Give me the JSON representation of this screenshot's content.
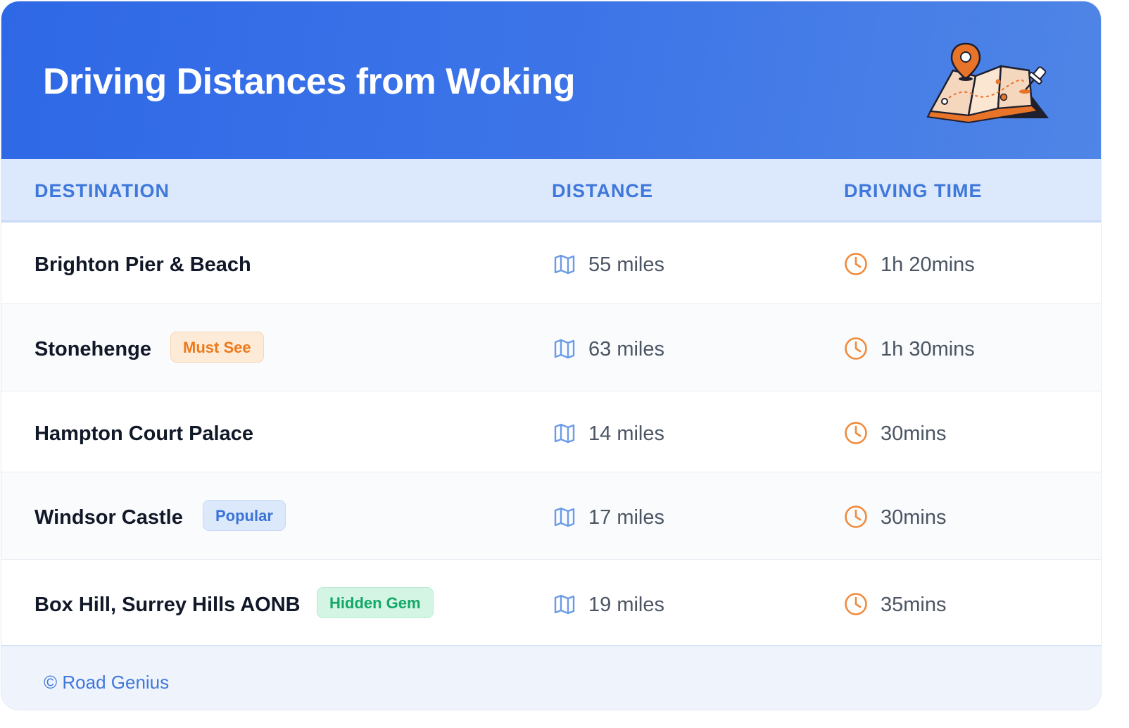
{
  "header": {
    "title": "Driving Distances from Woking",
    "illustration_icon": "map-with-pins-icon",
    "background_color": "#2f68e6"
  },
  "columns": {
    "destination": "DESTINATION",
    "distance": "DISTANCE",
    "driving_time": "DRIVING TIME"
  },
  "rows": [
    {
      "destination": "Brighton Pier & Beach",
      "badge": "",
      "distance": "55 miles",
      "time": "1h 20mins"
    },
    {
      "destination": "Stonehenge",
      "badge": "Must See",
      "badge_color": "#ec7a1c",
      "distance": "63 miles",
      "time": "1h 30mins"
    },
    {
      "destination": "Hampton Court Palace",
      "badge": "",
      "distance": "14 miles",
      "time": "30mins"
    },
    {
      "destination": "Windsor Castle",
      "badge": "Popular",
      "badge_color": "#3b73d8",
      "distance": "17 miles",
      "time": "30mins"
    },
    {
      "destination": "Box Hill, Surrey Hills AONB",
      "badge": "Hidden Gem",
      "badge_color": "#13a867",
      "distance": "19 miles",
      "time": "35mins"
    }
  ],
  "icons": {
    "distance": "map-icon",
    "time": "clock-icon"
  },
  "colors": {
    "accent": "#3f78db",
    "time_icon": "#f08a3c",
    "map_icon": "#6b9be6"
  },
  "footer": {
    "text": "© Road Genius"
  }
}
